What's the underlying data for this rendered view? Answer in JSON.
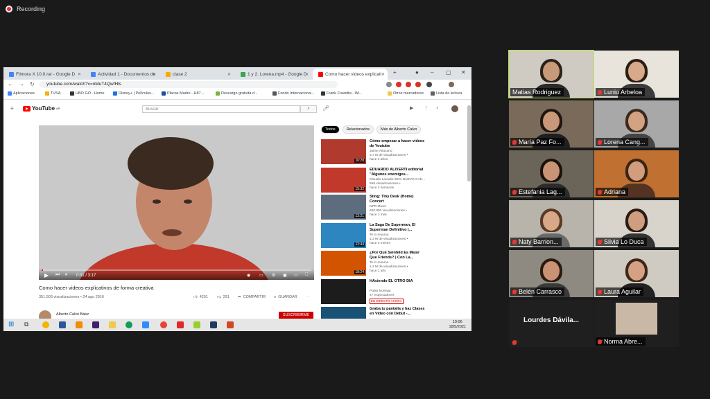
{
  "recording": {
    "label": "Recording"
  },
  "browser": {
    "tabs": [
      {
        "label": "Filmora X 10.0.rar - Google D",
        "color": "#4285f4",
        "active": false
      },
      {
        "label": "Actividad 1 - Documentos de",
        "color": "#4285f4",
        "active": false
      },
      {
        "label": "clase 2",
        "color": "#f9ab00",
        "active": false
      },
      {
        "label": "1 y 2. Lorena.mp4 - Google D",
        "color": "#34a853",
        "active": false
      },
      {
        "label": "Como hacer videos explicati",
        "color": "#ff0000",
        "active": true
      }
    ],
    "url": "youtube.com/watch?v=nMuT4QwfHls",
    "bookmarks": [
      "Aplicaciones",
      "TVSA",
      "HBO GO - Home",
      "Disney+ | Películas...",
      "Placas Madre - H87...",
      "Descargo gratuita d...",
      "Fondo Internaciona...",
      "Frank Frazetta - Wi...",
      "Otros marcadores",
      "Lista de lectura"
    ]
  },
  "youtube": {
    "logo": "YouTube",
    "logo_sup": "AR",
    "search_placeholder": "Buscar",
    "player": {
      "time": "0:01 / 3:17",
      "progress": 0.005
    },
    "video_title": "Como hacer videos explicativos de forma creativa",
    "views": "351.503 visualizaciones • 24 ago 2016",
    "likes": "4251",
    "dislikes": "291",
    "share_label": "COMPARTIR",
    "save_label": "GUARDAR",
    "channel": "Alberto Calvo Báez",
    "subscribe_label": "SUSCRIBIRME",
    "chips": [
      "Todos",
      "Relacionados",
      "Más de Alberto Calvo"
    ],
    "recommendations": [
      {
        "title": "Cómo empezar a hacer videos de Youtube",
        "meta": [
          "Jaime Altozano",
          "3,7 M de visualizaciones •",
          "hace 2 años"
        ],
        "duration": "16:28",
        "thumb": "#b03a2e"
      },
      {
        "title": "EDUARDO ALIVERTI editorial \"Algunos enemigos...",
        "meta": [
          "Claudio Lavadio 2021 NUEVO CAN...",
          "658 visualizaciones •",
          "hace 2 semanas"
        ],
        "duration": "15:32",
        "thumb": "#c0392b"
      },
      {
        "title": "Sting: Tiny Desk (Home) Concert",
        "meta": [
          "NPR Music",
          "828.800 visualizaciones •",
          "hace 1 mes"
        ],
        "duration": "12:21",
        "thumb": "#5d6d7e"
      },
      {
        "title": "La Saga De Superman, El Superman Definitivo |...",
        "meta": [
          "Te lo resumo",
          "1,3 M de visualizaciones •",
          "hace 3 meses"
        ],
        "duration": "12:44",
        "thumb": "#2e86c1"
      },
      {
        "title": "¿Por Qué Seinfeld Es Mejor Que Friends? | Con La...",
        "meta": [
          "Te lo resumo",
          "2,2 M de visualizaciones •",
          "hace 1 año"
        ],
        "duration": "18:24",
        "thumb": "#d35400"
      },
      {
        "title": "HAciendo EL OTRO DIA",
        "meta": [
          "Pablo Noriega",
          "47 espectadores"
        ],
        "live": "EN DIRECTO AHORA",
        "thumb": "#1c1c1c"
      },
      {
        "title": "Graba tu pantalla y haz Clases en Video con Debut -...",
        "meta": [],
        "thumb": "#1a5276"
      }
    ]
  },
  "taskbar": {
    "time": "19:06",
    "date": "18/5/2021"
  },
  "participants": [
    {
      "name": "Matias Rodriguez",
      "speaking": true,
      "muted": false,
      "bg": "#cfcac2",
      "skin": "#c99a7a",
      "hair": "#2b2118",
      "shirt": "#2a2a2a"
    },
    {
      "name": "Luniu Arbeloa",
      "speaking": false,
      "muted": true,
      "bg": "#e8e4dc",
      "skin": "#d8a98a",
      "hair": "#2c1d14",
      "shirt": "#3b3b3b"
    },
    {
      "name": "María Paz Fo...",
      "speaking": false,
      "muted": true,
      "bg": "#7a6a5a",
      "skin": "#c9987a",
      "hair": "#1f1610",
      "shirt": "#1f1f1f"
    },
    {
      "name": "Lorena Cang...",
      "speaking": false,
      "muted": true,
      "bg": "#a8a8a8",
      "skin": "#d3a283",
      "hair": "#3a2a1e",
      "shirt": "#444444"
    },
    {
      "name": "Estefania Lag...",
      "speaking": false,
      "muted": true,
      "bg": "#6b6459",
      "skin": "#c99476",
      "hair": "#1a120c",
      "shirt": "#2b2b2b"
    },
    {
      "name": "Adriana",
      "speaking": false,
      "muted": true,
      "bg": "#c07030",
      "skin": "#d39c7c",
      "hair": "#3a2414",
      "shirt": "#553322"
    },
    {
      "name": "Naty Barrion...",
      "speaking": false,
      "muted": true,
      "bg": "#b9b4ab",
      "skin": "#d8a888",
      "hair": "#5a3a24",
      "shirt": "#6a6a6a"
    },
    {
      "name": "Silvia Lo Duca",
      "speaking": false,
      "muted": true,
      "bg": "#d8d4cc",
      "skin": "#cf9d7f",
      "hair": "#2a1c14",
      "shirt": "#333333"
    },
    {
      "name": "Belén Carrasco",
      "speaking": false,
      "muted": true,
      "bg": "#8e8a82",
      "skin": "#c99274",
      "hair": "#2a1a10",
      "shirt": "#3a3a3a"
    },
    {
      "name": "Laura Aguilar",
      "speaking": false,
      "muted": true,
      "bg": "#cfcbc3",
      "skin": "#d4a184",
      "hair": "#3d2818",
      "shirt": "#222222"
    },
    {
      "name": "Lourdes Dávila...",
      "speaking": false,
      "muted": true,
      "video_off": true
    },
    {
      "name": "Norma Abre...",
      "speaking": false,
      "muted": true,
      "photo": true
    }
  ]
}
